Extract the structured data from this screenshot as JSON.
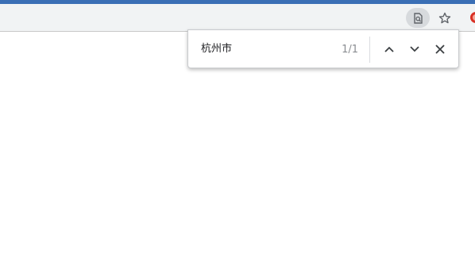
{
  "toolbar": {
    "find_icon": "find-in-page-icon",
    "star_icon": "bookmark-star-icon",
    "extension_icon": "extension-icon",
    "accent_color": "#3a6fb5"
  },
  "find_bar": {
    "query": "杭州市",
    "match_count": "1/1",
    "prev_icon": "chevron-up-icon",
    "next_icon": "chevron-down-icon",
    "close_icon": "close-icon"
  }
}
